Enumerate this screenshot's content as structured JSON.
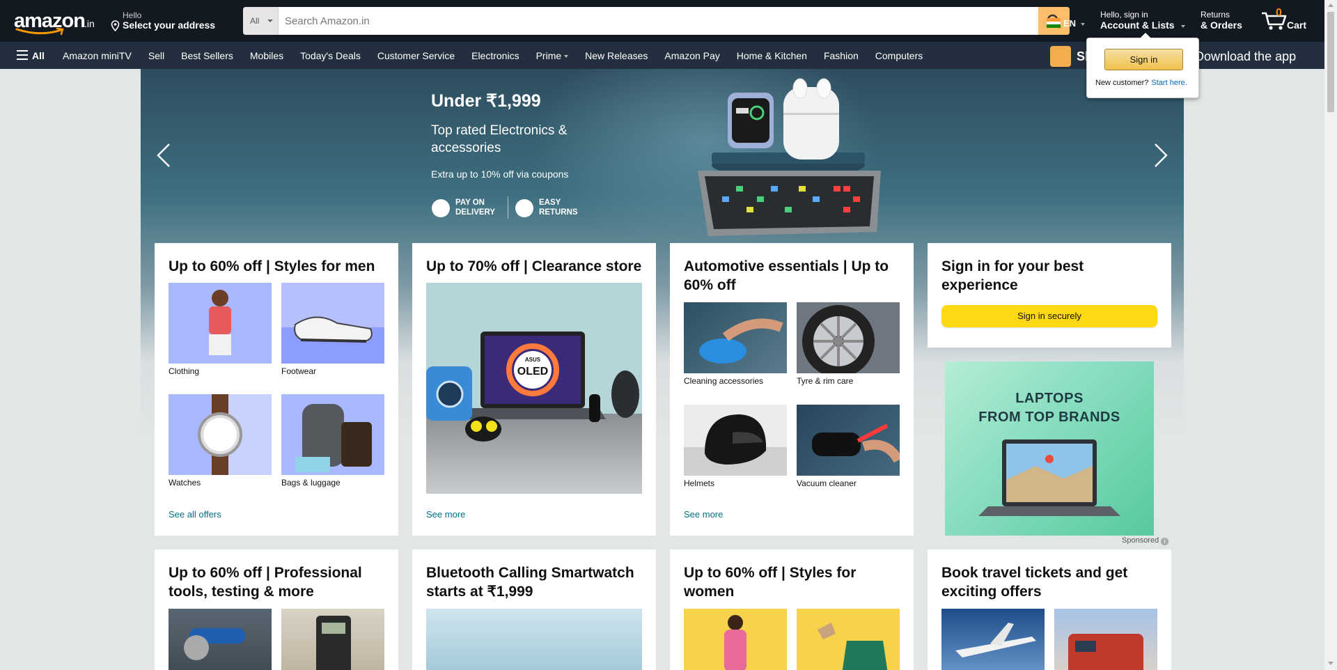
{
  "header": {
    "logo_text": "amazon",
    "logo_tld": ".in",
    "deliver_line1": "Hello",
    "deliver_line2": "Select your address",
    "search_category": "All",
    "search_placeholder": "Search Amazon.in",
    "language": "EN",
    "account_line1": "Hello, sign in",
    "account_line2": "Account & Lists",
    "orders_line1": "Returns",
    "orders_line2": "& Orders",
    "cart_count": "0",
    "cart_label": "Cart"
  },
  "subnav": {
    "all_label": "All",
    "links": [
      "Amazon miniTV",
      "Sell",
      "Best Sellers",
      "Mobiles",
      "Today's Deals",
      "Customer Service",
      "Electronics",
      "Prime",
      "New Releases",
      "Amazon Pay",
      "Home & Kitchen",
      "Fashion",
      "Computers"
    ],
    "promo_text": "Sh",
    "promo_text2": "Download the app"
  },
  "flyout": {
    "button": "Sign in",
    "new_customer": "New customer?",
    "start_here": "Start here."
  },
  "hero": {
    "headline": "Under ₹1,999",
    "subheadline": "Top rated Electronics & accessories",
    "offer": "Extra up to 10% off via coupons",
    "badge1": "PAY ON DELIVERY",
    "badge2": "EASY RETURNS"
  },
  "cards": {
    "men": {
      "title": "Up to 60% off | Styles for men",
      "tiles": [
        "Clothing",
        "Footwear",
        "Watches",
        "Bags & luggage"
      ],
      "link": "See all offers"
    },
    "clearance": {
      "title": "Up to 70% off | Clearance store",
      "link": "See more",
      "oled_text": "OLED",
      "asus_text": "ASUS"
    },
    "auto": {
      "title": "Automotive essentials | Up to 60% off",
      "tiles": [
        "Cleaning accessories",
        "Tyre & rim care",
        "Helmets",
        "Vacuum cleaner"
      ],
      "link": "See more"
    },
    "signin": {
      "title": "Sign in for your best experience",
      "button": "Sign in securely"
    },
    "tools": {
      "title": "Up to 60% off | Professional tools, testing & more"
    },
    "smartwatch": {
      "title": "Bluetooth Calling Smartwatch starts at ₹1,999"
    },
    "women": {
      "title": "Up to 60% off | Styles for women"
    },
    "travel": {
      "title": "Book travel tickets and get exciting offers"
    }
  },
  "ad": {
    "headline_line1": "LAPTOPS",
    "headline_line2": "FROM TOP BRANDS",
    "sponsored": "Sponsored"
  },
  "colors": {
    "nav_bg": "#131921",
    "subnav_bg": "#232f3e",
    "search_button": "#febd69",
    "link": "#007185",
    "sign_in_button": "#ffd814"
  }
}
